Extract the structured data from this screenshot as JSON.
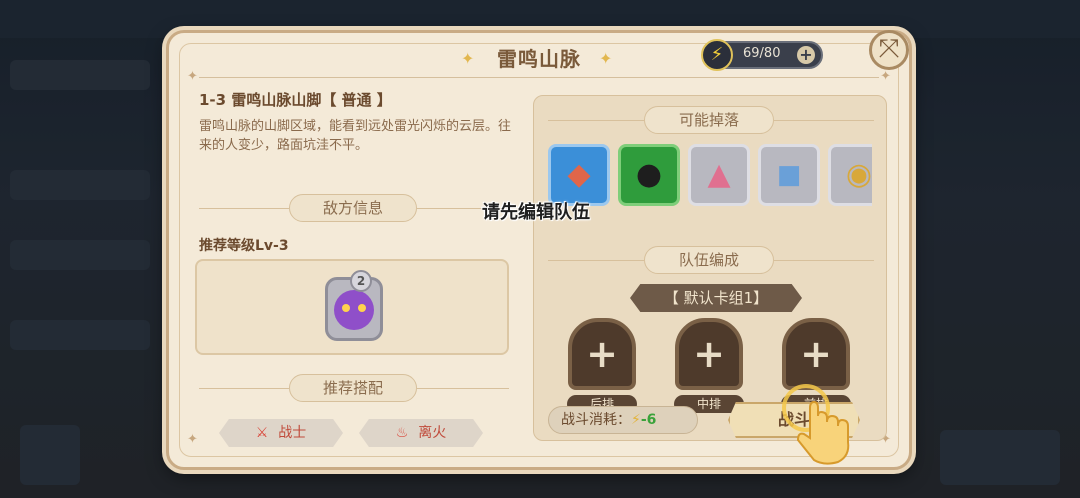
{
  "dialog": {
    "title": "雷鸣山脉",
    "energy": {
      "text": "69/80",
      "plus": "+"
    },
    "close_icon": "⤧"
  },
  "stage": {
    "title": "1-3 雷鸣山脉山脚【 普通 】",
    "description": "雷鸣山脉的山脚区域，能看到远处雷光闪烁的云层。往来的人变少，路面坑洼不平。"
  },
  "enemy_info": {
    "header": "敌方信息",
    "recommended_level": "推荐等级Lv-3",
    "enemy_level": "2"
  },
  "recommend": {
    "header": "推荐搭配",
    "tags": [
      {
        "label": "战士",
        "icon": "sword-icon"
      },
      {
        "label": "离火",
        "icon": "fire-icon"
      }
    ]
  },
  "drops": {
    "header": "可能掉落",
    "items": [
      {
        "name": "red-crystal-icon",
        "color": "#3b8fd8"
      },
      {
        "name": "black-ore-icon",
        "color": "#2f9c3c"
      },
      {
        "name": "pink-cloth-icon",
        "color": "#b8b8c0"
      },
      {
        "name": "exp-book-icon",
        "color": "#b8b8c0"
      },
      {
        "name": "gold-coin-icon",
        "color": "#b8b8c0"
      }
    ]
  },
  "team": {
    "header": "队伍编成",
    "deck_name": "【 默认卡组1】",
    "slots": [
      {
        "label": "后排"
      },
      {
        "label": "中排"
      },
      {
        "label": "前排"
      }
    ],
    "cost_label": "战斗消耗：",
    "cost_value": "-6",
    "battle_button": "战斗"
  },
  "tooltip": "请先编辑队伍"
}
